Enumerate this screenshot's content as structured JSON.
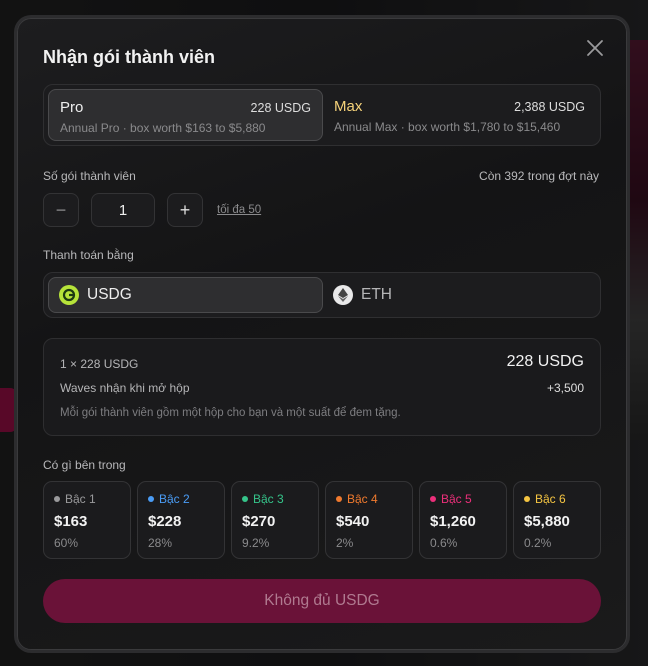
{
  "modal": {
    "title": "Nhận gói thành viên"
  },
  "plans": [
    {
      "name": "Pro",
      "price": "228 USDG",
      "desc": "Annual Pro · box worth $163 to $5,880",
      "selected": true
    },
    {
      "name": "Max",
      "price": "2,388 USDG",
      "desc": "Annual Max · box worth $1,780 to $15,460",
      "selected": false
    }
  ],
  "quantity": {
    "label": "Số gói thành viên",
    "remaining": "Còn 392 trong đợt này",
    "value": "1",
    "minus": "−",
    "plus": "+",
    "max_link": "tối đa 50"
  },
  "payment": {
    "label": "Thanh toán bằng",
    "options": [
      {
        "name": "USDG",
        "icon": "usdg-coin-icon",
        "selected": true
      },
      {
        "name": "ETH",
        "icon": "eth-coin-icon",
        "selected": false
      }
    ]
  },
  "summary": {
    "line": "1 × 228 USDG",
    "total": "228 USDG",
    "waves_label": "Waves nhận khi mở hộp",
    "waves_value": "+3,500",
    "note": "Mỗi gói thành viên gồm một hộp cho bạn và một suất để đem tặng."
  },
  "contents": {
    "label": "Có gì bên trong",
    "tiers": [
      {
        "name": "Bậc 1",
        "price": "$163",
        "pct": "60%",
        "color": "#9a9a9c"
      },
      {
        "name": "Bậc 2",
        "price": "$228",
        "pct": "28%",
        "color": "#4a9cf5"
      },
      {
        "name": "Bậc 3",
        "price": "$270",
        "pct": "9.2%",
        "color": "#35c48a"
      },
      {
        "name": "Bậc 4",
        "price": "$540",
        "pct": "2%",
        "color": "#f07a2e"
      },
      {
        "name": "Bậc 5",
        "price": "$1,260",
        "pct": "0.6%",
        "color": "#ec2f7a"
      },
      {
        "name": "Bậc 6",
        "price": "$5,880",
        "pct": "0.2%",
        "color": "#f5c542"
      }
    ]
  },
  "submit": {
    "label": "Không đủ USDG"
  },
  "colors": {
    "accent": "#6a1238",
    "max_gold": "#f5d27a"
  }
}
